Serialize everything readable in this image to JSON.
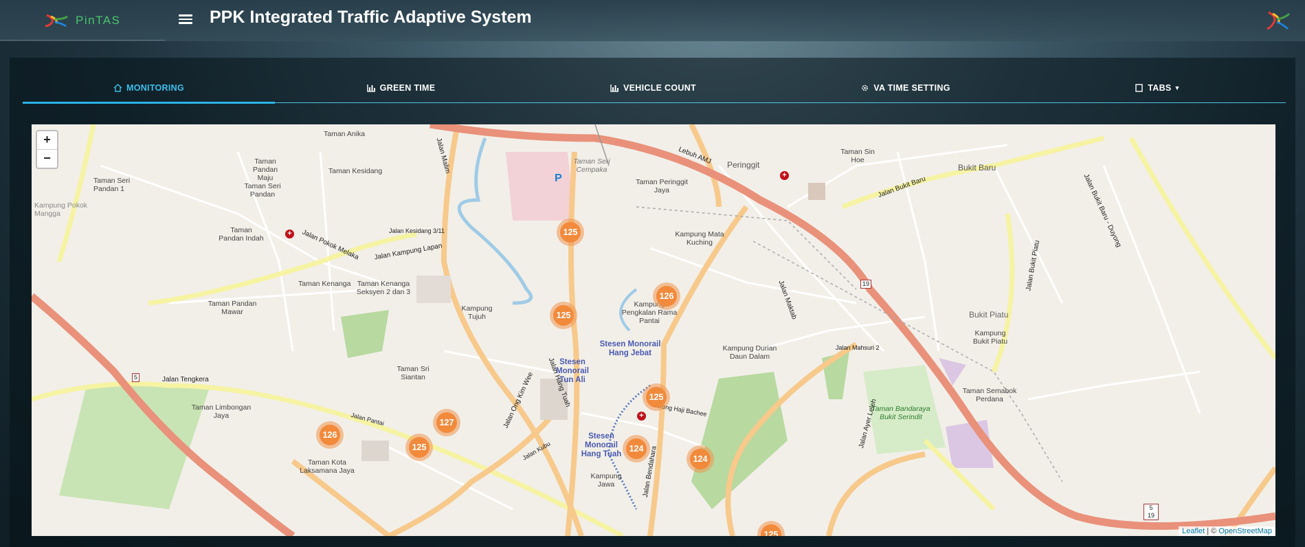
{
  "header": {
    "brand_name": "PinTAS",
    "app_title": "PPK Integrated Traffic Adaptive System"
  },
  "tabs": [
    {
      "label": "MONITORING",
      "icon": "home-icon",
      "active": true
    },
    {
      "label": "GREEN TIME",
      "icon": "bar-chart-icon",
      "active": false
    },
    {
      "label": "VEHICLE COUNT",
      "icon": "bar-chart-icon",
      "active": false
    },
    {
      "label": "VA TIME SETTING",
      "icon": "gear-icon",
      "active": false
    },
    {
      "label": "TABS",
      "icon": "book-icon",
      "active": false,
      "dropdown": true
    }
  ],
  "map": {
    "zoom_in": "+",
    "zoom_out": "−",
    "attribution_leaflet": "Leaflet",
    "attribution_sep": " | © ",
    "attribution_osm": "OpenStreetMap",
    "clusters": [
      "125",
      "126",
      "125",
      "125",
      "127",
      "126",
      "125",
      "124",
      "124",
      "125"
    ],
    "places": [
      "Taman Anika",
      "Taman Pandan Maju",
      "Taman Seri Pandan 1",
      "Taman Kesidang",
      "Taman Seri Pandan",
      "Kampung Pokok Mangga",
      "Taman Pandan Indah",
      "Taman Pandan Mawar",
      "Taman Kenanga",
      "Taman Kenanga Seksyen 2 dan 3",
      "Kampung Tujuh",
      "Taman Sri Siantan",
      "Taman Limbongan Jaya",
      "Taman Kota Laksamana Jaya",
      "Kampung Jawa",
      "Kampung Pengkalan Rama Pantai",
      "Kampung Mata Kuching",
      "Taman Peringgit Jaya",
      "Peringgit",
      "Taman Sin Hoe",
      "Bukit Baru",
      "Kampung Durian Daun Dalam",
      "Kampung Bukit Piatu",
      "Bukit Piatu",
      "Taman Semabok Perdana",
      "Taman Seri Cempaka"
    ],
    "stations": [
      "Stesen Monorail Hang Jebat",
      "Stesen Monorail Tun Ali",
      "Stesen Monorail Hang Tuah"
    ],
    "parks": [
      "Taman Bandaraya Bukit Serindit"
    ],
    "roads": [
      "Lebuh AMJ",
      "Jalan Bukit Baru",
      "Jalan Tengkera",
      "Jalan Kampung Lapan",
      "Jalan Pokok Melaka",
      "Jalan Hang Tuah",
      "Jalan Ong Kim Wee",
      "Jalan Malim",
      "Jalan Maktab",
      "Jalan Ayer Leleh",
      "Jalan Bukit Piatu",
      "Jalan Bukit Baru - Duyong",
      "Jalan Mahsuri 2",
      "Jalan Kesidang 3/11",
      "Jalan Bendahara",
      "Lorong Haji Bachee",
      "Jalan Kubu",
      "Jalan Pantai"
    ],
    "route_shields": [
      "5",
      "19",
      "5 19"
    ]
  }
}
